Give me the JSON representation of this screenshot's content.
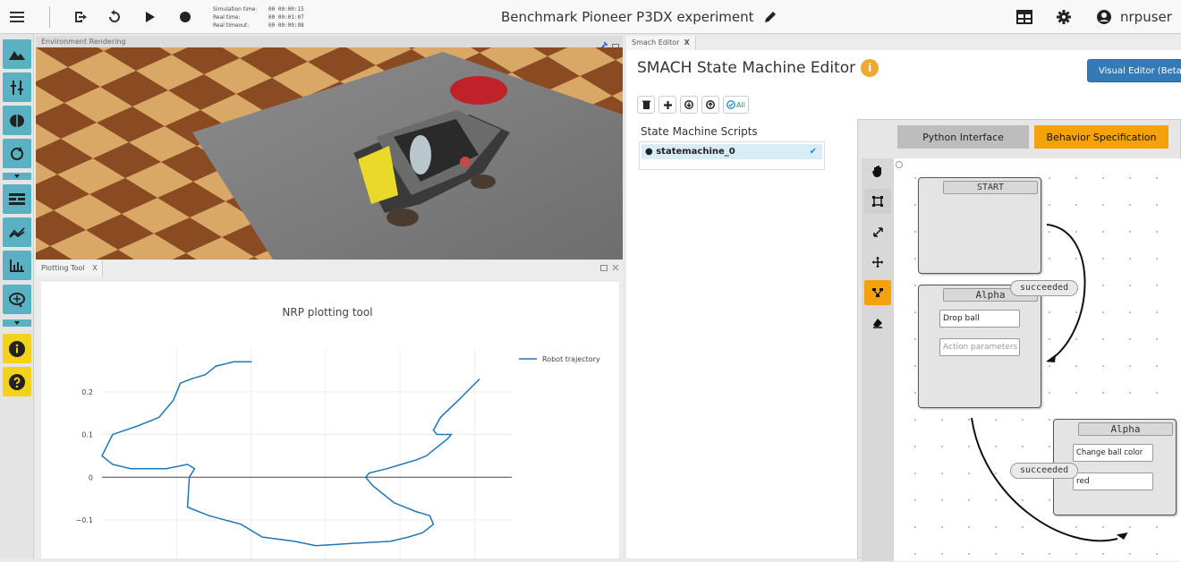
{
  "topbar": {
    "title": "Benchmark Pioneer P3DX experiment",
    "username": "nrpuser",
    "times": [
      {
        "label": "Simulation time:",
        "value": "00 00:00:15"
      },
      {
        "label": "Real time:",
        "value": "00 00:01:07"
      },
      {
        "label": "Real timeout:",
        "value": "00 00:09:08"
      }
    ],
    "icons": [
      "menu-icon",
      "exit-icon",
      "reset-icon",
      "play-icon",
      "record-icon",
      "edit-icon",
      "layout-icon",
      "gear-icon",
      "user-icon"
    ]
  },
  "leftbar": {
    "icons": [
      "terrain-icon",
      "transfer-icon",
      "brain-icon",
      "cycle-icon",
      "editor-icon",
      "spikes-icon",
      "chart-icon",
      "brain-scan-icon",
      "info-icon",
      "help-icon"
    ]
  },
  "env": {
    "tab_label": "Environment Rendering"
  },
  "plot": {
    "tab_label": "Plotting Tool",
    "tab_close": "X",
    "chart_data": {
      "type": "line",
      "title": "NRP plotting tool",
      "series": [
        {
          "name": "Robot trajectory",
          "color": "#1f77b4",
          "segments": [
            [
              [
                4.2,
                0.27
              ],
              [
                3.7,
                0.27
              ],
              [
                3.2,
                0.26
              ],
              [
                2.9,
                0.24
              ],
              [
                2.5,
                0.23
              ],
              [
                2.2,
                0.22
              ],
              [
                2.0,
                0.18
              ],
              [
                1.6,
                0.14
              ],
              [
                1.0,
                0.12
              ],
              [
                0.3,
                0.1
              ],
              [
                0,
                0.05
              ],
              [
                0.3,
                0.03
              ],
              [
                0.8,
                0.02
              ],
              [
                1.8,
                0.02
              ],
              [
                2.4,
                0.03
              ],
              [
                2.6,
                0.02
              ],
              [
                2.45,
                0.0
              ],
              [
                2.4,
                -0.07
              ],
              [
                3.0,
                -0.09
              ],
              [
                3.9,
                -0.11
              ],
              [
                4.5,
                -0.14
              ],
              [
                5.4,
                -0.15
              ],
              [
                6.0,
                -0.16
              ],
              [
                7.0,
                -0.155
              ],
              [
                8.1,
                -0.15
              ],
              [
                8.6,
                -0.14
              ],
              [
                9.0,
                -0.13
              ],
              [
                9.3,
                -0.11
              ],
              [
                9.2,
                -0.09
              ],
              [
                8.8,
                -0.08
              ],
              [
                8.2,
                -0.06
              ],
              [
                7.9,
                -0.04
              ],
              [
                7.6,
                -0.02
              ],
              [
                7.4,
                0.0
              ],
              [
                7.5,
                0.01
              ],
              [
                8.0,
                0.02
              ],
              [
                8.4,
                0.03
              ],
              [
                8.8,
                0.04
              ],
              [
                9.1,
                0.05
              ],
              [
                9.4,
                0.07
              ],
              [
                9.7,
                0.09
              ],
              [
                9.8,
                0.1
              ],
              [
                9.4,
                0.1
              ],
              [
                9.3,
                0.11
              ],
              [
                9.5,
                0.14
              ],
              [
                10.0,
                0.18
              ],
              [
                10.6,
                0.23
              ]
            ]
          ]
        }
      ],
      "yticks": [
        0.2,
        0.1,
        0,
        -0.1
      ],
      "ytick_labels": [
        "0.2",
        "0.1",
        "0",
        "−0.1"
      ],
      "ylim": [
        -0.19,
        0.3
      ],
      "xlim": [
        0,
        11.5
      ],
      "grid": true,
      "legend": "top-right"
    }
  },
  "smach": {
    "tab_label": "Smach Editor",
    "tab_close": "X",
    "title": "SMACH State Machine Editor",
    "info_icon": "i",
    "visual_editor_button": "Visual Editor (Beta)",
    "toolbar": {
      "all_label": "All",
      "icons": [
        "delete-icon",
        "add-icon",
        "download-icon",
        "upload-icon",
        "check-all-icon"
      ]
    },
    "scripts_label": "State Machine Scripts",
    "scripts": [
      {
        "name": "statemachine_0",
        "checked": true
      }
    ],
    "canvas": {
      "tabs": [
        {
          "label": "Python Interface",
          "active": false
        },
        {
          "label": "Behavior Specification",
          "active": true
        }
      ],
      "tools": [
        "hand-icon",
        "select-icon",
        "resize-icon",
        "move-icon",
        "connect-icon",
        "erase-icon"
      ],
      "active_tool": "connect-icon",
      "states": [
        {
          "title": "START",
          "fields": []
        },
        {
          "title": "Alpha",
          "fields": [
            {
              "value": "Drop ball",
              "placeholder": false
            },
            {
              "value": "Action parameters",
              "placeholder": true
            }
          ]
        },
        {
          "title": "Alpha",
          "fields": [
            {
              "value": "Change ball color",
              "placeholder": false
            },
            {
              "value": "red",
              "placeholder": false
            }
          ]
        }
      ],
      "transitions": [
        "succeeded",
        "succeeded"
      ]
    }
  }
}
